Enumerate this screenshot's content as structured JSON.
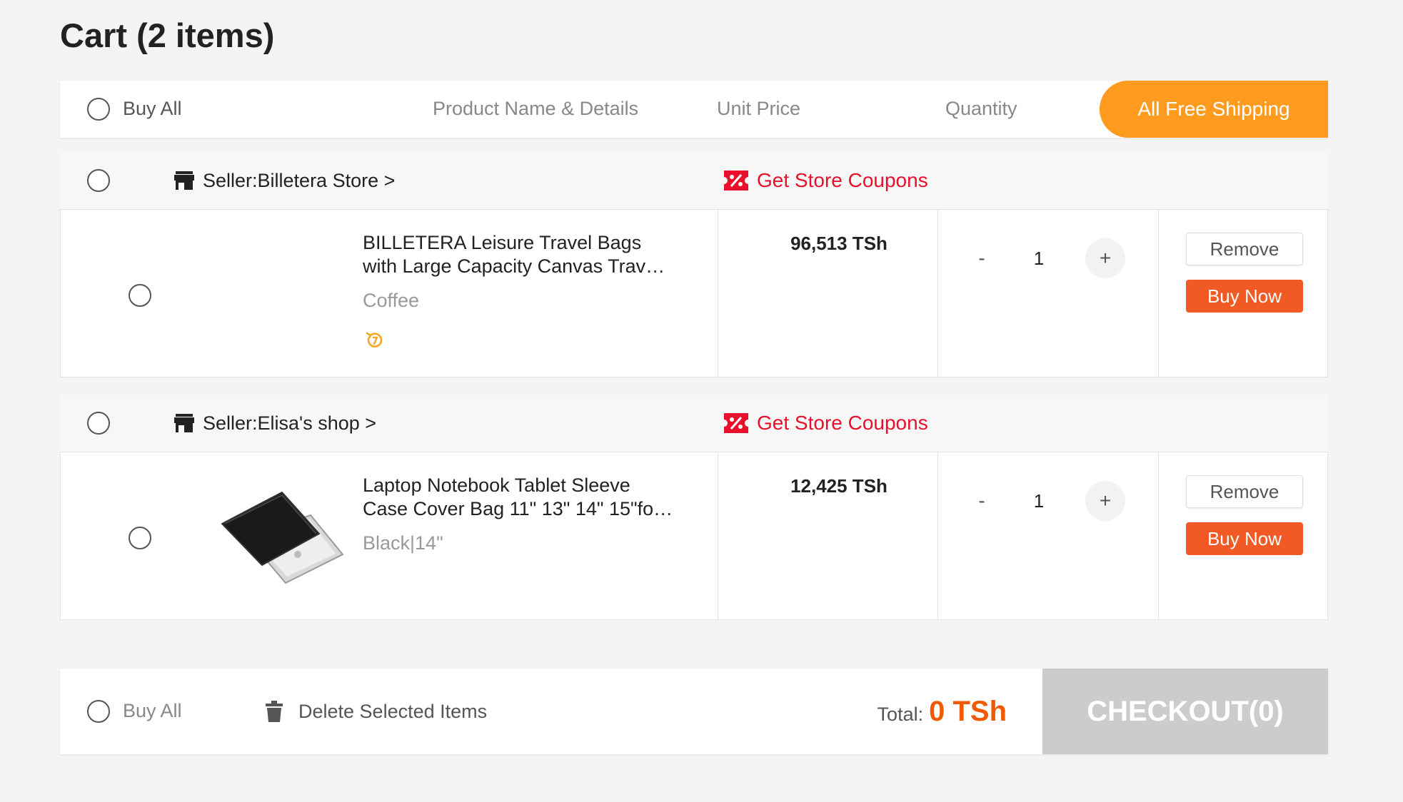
{
  "page": {
    "title": "Cart (2 items)"
  },
  "header": {
    "buy_all": "Buy All",
    "product_col": "Product Name & Details",
    "price_col": "Unit Price",
    "quantity_col": "Quantity",
    "shipping_badge": "All Free Shipping"
  },
  "sellers": [
    {
      "name": "Seller:Billetera Store >",
      "coupons": "Get Store Coupons",
      "item": {
        "title_line1": "BILLETERA Leisure Travel Bags",
        "title_line2": "with Large Capacity Canvas Trav…",
        "variant": "Coffee",
        "price": "96,513 TSh",
        "qty_minus": "-",
        "quantity": "1",
        "qty_plus": "+",
        "remove": "Remove",
        "buy_now": "Buy Now",
        "has_image": false,
        "has_reload_icon": true
      }
    },
    {
      "name": "Seller:Elisa's shop >",
      "coupons": "Get Store Coupons",
      "item": {
        "title_line1": "Laptop Notebook Tablet Sleeve",
        "title_line2": "Case Cover Bag 11\" 13\" 14\" 15\"fo…",
        "variant": "Black|14\"",
        "price": "12,425 TSh",
        "qty_minus": "-",
        "quantity": "1",
        "qty_plus": "+",
        "remove": "Remove",
        "buy_now": "Buy Now",
        "has_image": true,
        "has_reload_icon": false
      }
    }
  ],
  "footer": {
    "buy_all": "Buy All",
    "delete_selected": "Delete Selected Items",
    "total_label": "Total:",
    "total_value": "0 TSh",
    "checkout": "CHECKOUT(0)"
  },
  "colors": {
    "accent_orange": "#ff9b1f",
    "buy_now": "#f15a24",
    "coupon_red": "#e8102b",
    "total_orange": "#f15a00",
    "checkout_disabled": "#cccccc"
  },
  "icons": {
    "store": "store-icon",
    "coupon": "coupon-icon",
    "reload": "reload-icon",
    "trash": "trash-icon"
  }
}
